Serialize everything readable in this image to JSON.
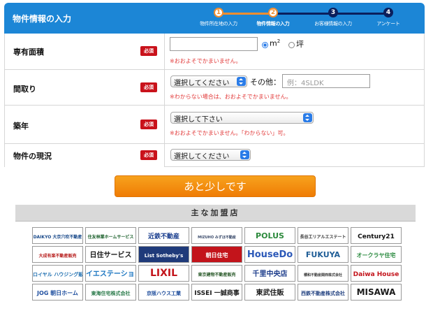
{
  "header": {
    "title": "物件情報の入力",
    "steps": [
      {
        "number": "1",
        "label": "物件所在地の入力"
      },
      {
        "number": "2",
        "label": "物件情報の入力"
      },
      {
        "number": "3",
        "label": "お客様情報の入力"
      },
      {
        "number": "4",
        "label": "アンケート"
      }
    ],
    "colors": {
      "bar": "#1c86d6",
      "done": "#f18d2f",
      "todo": "#0b1f5c"
    }
  },
  "form": {
    "required_label": "必須",
    "area": {
      "label": "専有面積",
      "value": "",
      "unit_m2": "m",
      "unit_m2_sup": "2",
      "unit_tsubo": "坪",
      "note": "※おおよそでかまいません。"
    },
    "layout": {
      "label": "間取り",
      "select_value": "選択してください",
      "other_label": "その他：",
      "other_placeholder": "例：4SLDK",
      "note": "※わからない場合は、おおよそでかまいません。"
    },
    "age": {
      "label": "築年",
      "select_value": "選択して下さい",
      "note": "※おおよそでかまいません。「わからない」可。"
    },
    "status": {
      "label": "物件の現況",
      "select_value": "選択してください"
    }
  },
  "submit_label": "あと少しです",
  "partners": {
    "title": "主な加盟店",
    "logos": [
      [
        "DAIKYO 大京穴吹不動産",
        "住友林業ホームサービス",
        "近鉄不動産",
        "MIZUHO みずほ不動産",
        "POLUS",
        "長谷工リアルエステート",
        "Century21"
      ],
      [
        "大成有楽不動産販売",
        "日住サービス",
        "List Sotheby's",
        "朝日住宅",
        "HouseDo",
        "FUKUYA",
        "オークラヤ住宅"
      ],
      [
        "ロイヤル ハウジング販売",
        "イエステーション",
        "LIXIL",
        "東京建物不動産販売",
        "千里中央店",
        "積和不動産関西株式会社",
        "Daiwa House"
      ],
      [
        "JOG 朝日ホーム",
        "東海住宅株式会社",
        "京阪ハウス工業",
        "ISSEI 一誠商事",
        "東武住販",
        "西鉄不動産株式会社",
        "MISAWA"
      ]
    ]
  }
}
